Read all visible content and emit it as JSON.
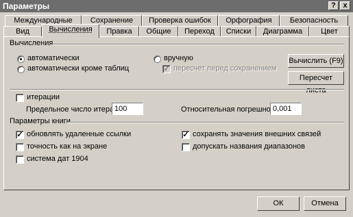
{
  "window": {
    "title": "Параметры",
    "help_button": "?",
    "close_button": "x"
  },
  "tabs_row1": [
    {
      "label": "Международные"
    },
    {
      "label": "Сохранение"
    },
    {
      "label": "Проверка ошибок"
    },
    {
      "label": "Орфография"
    },
    {
      "label": "Безопасность"
    }
  ],
  "tabs_row2": [
    {
      "label": "Вид"
    },
    {
      "label": "Вычисления"
    },
    {
      "label": "Правка"
    },
    {
      "label": "Общие"
    },
    {
      "label": "Переход"
    },
    {
      "label": "Списки"
    },
    {
      "label": "Диаграмма"
    },
    {
      "label": "Цвет"
    }
  ],
  "calc": {
    "group_title": "Вычисления",
    "automatic": "автоматически",
    "automatic_except_tables": "автоматически кроме таблиц",
    "manual": "вручную",
    "recalc_before_save": "пересчет перед сохранением",
    "recalc_button": "Вычислить (F9)",
    "recalc_sheet_button": "Пересчет листа",
    "iterations": "итерации",
    "max_iterations_label": "Предельное число итераций:",
    "max_iterations_value": "100",
    "relative_error_label": "Относительная погрешность:",
    "relative_error_value": "0,001"
  },
  "book": {
    "group_title": "Параметры книги",
    "update_remote_refs": "обновлять удаленные ссылки",
    "save_external_values": "сохранять значения внешних связей",
    "precision_as_displayed": "точность как на экране",
    "accept_range_labels": "допускать названия диапазонов",
    "date_system_1904": "система дат 1904"
  },
  "footer": {
    "ok": "ОК",
    "cancel": "Отмена"
  }
}
